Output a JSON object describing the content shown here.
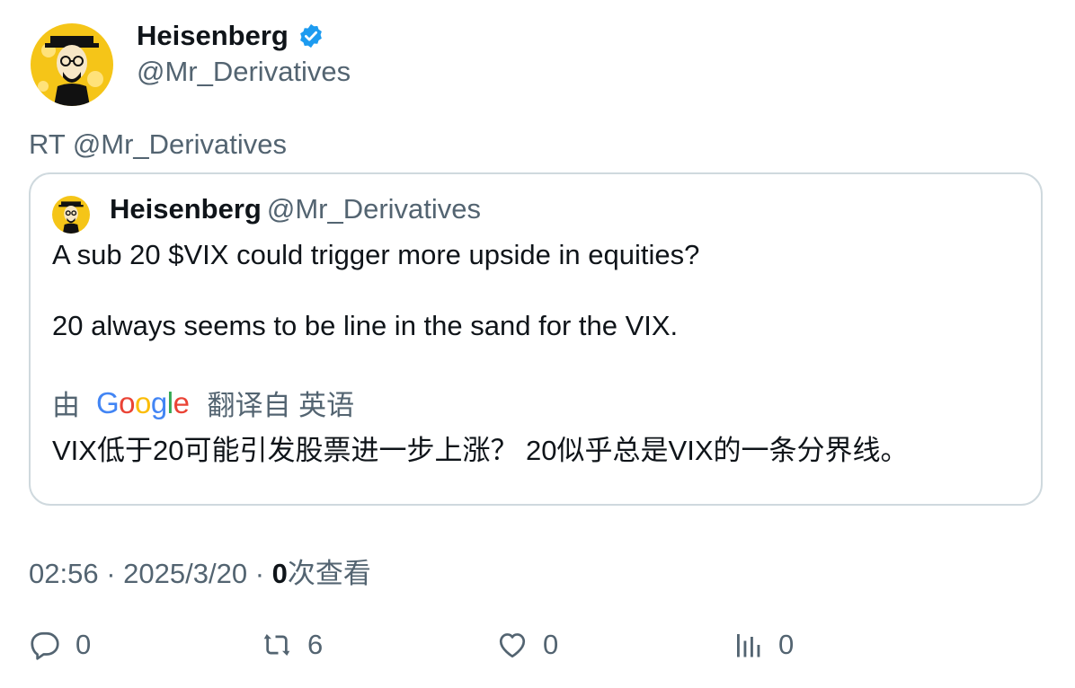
{
  "author": {
    "name": "Heisenberg",
    "handle": "@Mr_Derivatives"
  },
  "retweet_line": "RT @Mr_Derivatives",
  "quote": {
    "name": "Heisenberg",
    "handle": "@Mr_Derivatives",
    "text_line1": "A sub 20 $VIX could trigger more upside in equities?",
    "text_line2": "20 always seems to be line in the sand for the VIX.",
    "translated_by_prefix": "由",
    "translated_from": "翻译自 英语",
    "translation": "VIX低于20可能引发股票进一步上涨？ 20似乎总是VIX的一条分界线。"
  },
  "meta": {
    "time": "02:56",
    "separator": "·",
    "date": "2025/3/20",
    "views_count": "0",
    "views_label": "次查看"
  },
  "actions": {
    "reply_count": "0",
    "retweet_count": "6",
    "like_count": "0",
    "views_count": "0"
  },
  "colors": {
    "text_primary": "#0f1419",
    "text_secondary": "#536471",
    "border": "#cfd9de",
    "verified": "#1d9bf0",
    "avatar_bg": "#f5c518"
  },
  "icons": [
    "verified-badge-icon",
    "reply-icon",
    "retweet-icon",
    "like-icon",
    "views-icon"
  ]
}
